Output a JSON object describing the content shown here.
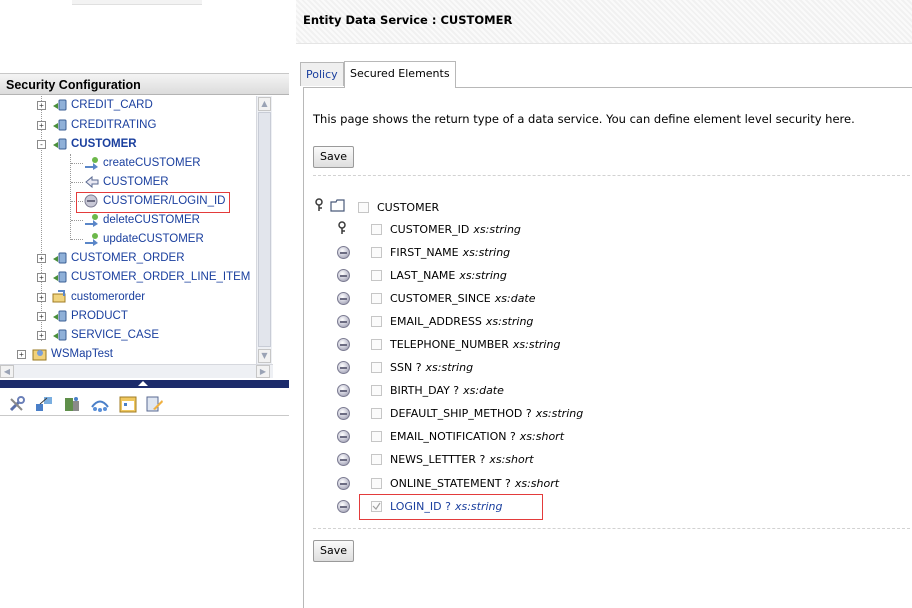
{
  "left_panel": {
    "title": "Security Configuration",
    "tree": [
      {
        "label": "CREDIT_CARD",
        "icon": "data-service-icon",
        "toggle": "+"
      },
      {
        "label": "CREDITRATING",
        "icon": "data-service-icon",
        "toggle": "+"
      },
      {
        "label": "CUSTOMER",
        "icon": "data-service-icon",
        "toggle": "-"
      },
      {
        "label": "createCUSTOMER",
        "icon": "create-operation-icon"
      },
      {
        "label": "CUSTOMER",
        "icon": "read-function-icon"
      },
      {
        "label": "CUSTOMER/LOGIN_ID",
        "icon": "secured-element-icon"
      },
      {
        "label": "deleteCUSTOMER",
        "icon": "delete-operation-icon"
      },
      {
        "label": "updateCUSTOMER",
        "icon": "update-operation-icon"
      },
      {
        "label": "CUSTOMER_ORDER",
        "icon": "data-service-icon",
        "toggle": "+"
      },
      {
        "label": "CUSTOMER_ORDER_LINE_ITEM",
        "icon": "data-service-icon",
        "toggle": "+"
      },
      {
        "label": "customerorder",
        "icon": "folder-service-icon",
        "toggle": "+"
      },
      {
        "label": "PRODUCT",
        "icon": "data-service-icon",
        "toggle": "+"
      },
      {
        "label": "SERVICE_CASE",
        "icon": "data-service-icon",
        "toggle": "+"
      },
      {
        "label": "WSMapTest",
        "icon": "project-icon",
        "toggle": "+"
      }
    ],
    "toolbar_icons": [
      "tools-icon",
      "hierarchy-icon",
      "server-icon",
      "network-icon",
      "calendar-icon",
      "edit-icon"
    ]
  },
  "right_panel": {
    "title": "Entity Data Service : CUSTOMER",
    "tabs": [
      {
        "label": "Policy"
      },
      {
        "label": "Secured Elements"
      }
    ],
    "intro": "This page shows the return type of a data service. You can define element level security here.",
    "save_label": "Save",
    "root": {
      "name": "CUSTOMER"
    },
    "elements": [
      {
        "name": "CUSTOMER_ID",
        "type": "xs:string",
        "icon": "key-icon",
        "checked": false
      },
      {
        "name": "FIRST_NAME",
        "type": "xs:string",
        "icon": "element-icon",
        "checked": false
      },
      {
        "name": "LAST_NAME",
        "type": "xs:string",
        "icon": "element-icon",
        "checked": false
      },
      {
        "name": "CUSTOMER_SINCE",
        "type": "xs:date",
        "icon": "element-icon",
        "checked": false
      },
      {
        "name": "EMAIL_ADDRESS",
        "type": "xs:string",
        "icon": "element-icon",
        "checked": false
      },
      {
        "name": "TELEPHONE_NUMBER",
        "type": "xs:string",
        "icon": "element-icon",
        "checked": false
      },
      {
        "name": "SSN ?",
        "type": "xs:string",
        "icon": "element-icon",
        "checked": false
      },
      {
        "name": "BIRTH_DAY ?",
        "type": "xs:date",
        "icon": "element-icon",
        "checked": false
      },
      {
        "name": "DEFAULT_SHIP_METHOD ?",
        "type": "xs:string",
        "icon": "element-icon",
        "checked": false
      },
      {
        "name": "EMAIL_NOTIFICATION ?",
        "type": "xs:short",
        "icon": "element-icon",
        "checked": false
      },
      {
        "name": "NEWS_LETTTER ?",
        "type": "xs:short",
        "icon": "element-icon",
        "checked": false
      },
      {
        "name": "ONLINE_STATEMENT ?",
        "type": "xs:short",
        "icon": "element-icon",
        "checked": false
      },
      {
        "name": "LOGIN_ID ?",
        "type": "xs:string",
        "icon": "element-icon",
        "checked": true
      }
    ]
  },
  "colors": {
    "link": "#1a3f9e",
    "highlight": "#e33b3b",
    "splitter": "#1c2b6b"
  }
}
